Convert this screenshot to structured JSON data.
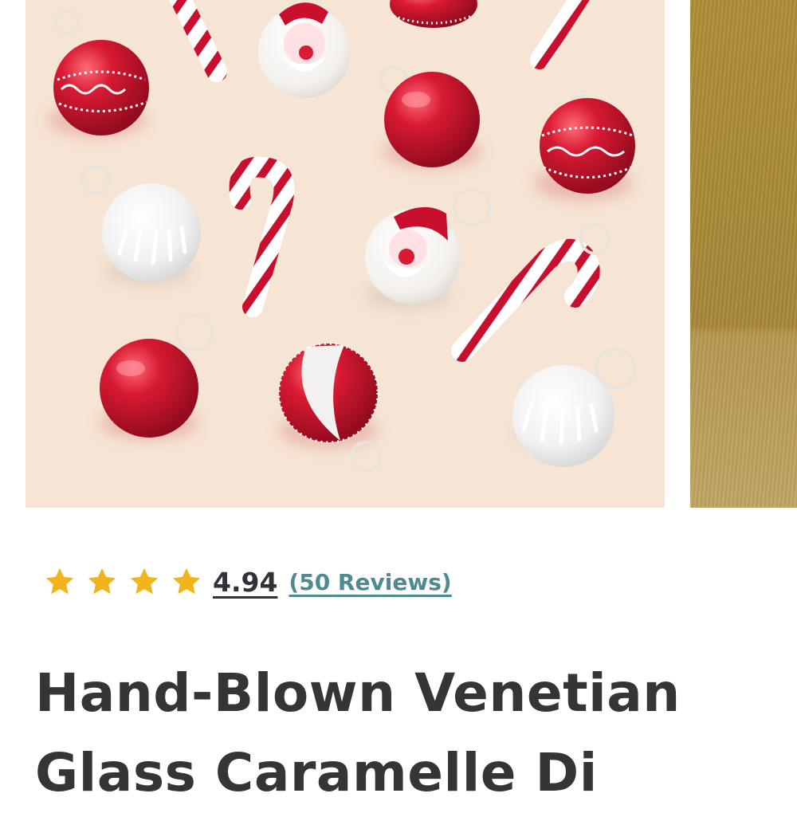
{
  "gallery": {
    "main_image": "christmas-glass-ornaments-photo",
    "next_image": "gold-background-photo",
    "colors": {
      "backdrop": "#f6e5d4",
      "ornament_red": "#c8102e",
      "gold": "#b08f38"
    }
  },
  "rating": {
    "stars_filled": 4,
    "score": "4.94",
    "reviews_link": "(50 Reviews)",
    "star_color": "#f2b41b"
  },
  "product": {
    "title_line1": "Hand-Blown Venetian",
    "title_line2": "Glass Caramelle Di"
  }
}
